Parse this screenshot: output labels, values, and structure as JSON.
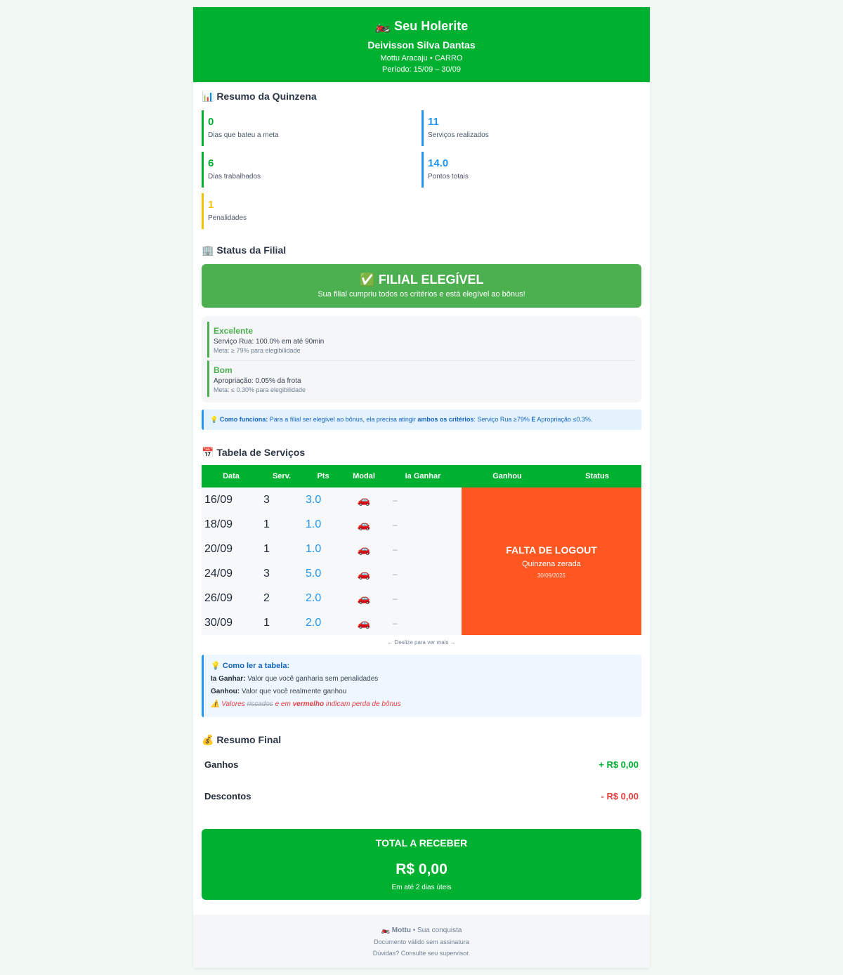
{
  "header": {
    "title": "🏍️ Seu Holerite",
    "name": "Deivisson Silva Dantas",
    "branch": "Mottu Aracaju • CARRO",
    "period": "Período: 15/09 – 30/09"
  },
  "summary": {
    "title": "📊 Resumo da Quinzena",
    "stats": [
      {
        "value": "0",
        "label": "Dias que bateu a meta"
      },
      {
        "value": "11",
        "label": "Serviços realizados"
      },
      {
        "value": "6",
        "label": "Dias trabalhados"
      },
      {
        "value": "14.0",
        "label": "Pontos totais"
      },
      {
        "value": "1",
        "label": "Penalidades"
      }
    ]
  },
  "filial": {
    "title": "🏢 Status da Filial",
    "status": "✅ FILIAL ELEGÍVEL",
    "status_sub": "Sua filial cumpriu todos os critérios e está elegível ao bônus!",
    "criteria": [
      {
        "level": "Excelente",
        "desc": "Serviço Rua: 100.0% em até 90min",
        "meta": "Meta: ≥ 79% para elegibilidade"
      },
      {
        "level": "Bom",
        "desc": "Apropriação: 0.05% da frota",
        "meta": "Meta: ≤ 0.30% para elegibilidade"
      }
    ],
    "info": {
      "icon": "💡",
      "label": "Como funciona:",
      "t1": " Para a filial ser elegível ao bônus, ela precisa atingir ",
      "bold": "ambos os critérios",
      "t2": ": Serviço Rua ≥79% ",
      "and": "E",
      "t3": " Apropriação ≤0.3%."
    }
  },
  "table": {
    "title": "📅 Tabela de Serviços",
    "headers": [
      "Data",
      "Serv.",
      "Pts",
      "Modal",
      "Ia Ganhar",
      "Ganhou",
      "Status"
    ],
    "rows": [
      {
        "date": "16/09",
        "serv": "3",
        "pts": "3.0",
        "modal": "🚗",
        "ia": "–"
      },
      {
        "date": "18/09",
        "serv": "1",
        "pts": "1.0",
        "modal": "🚗",
        "ia": "–"
      },
      {
        "date": "20/09",
        "serv": "1",
        "pts": "1.0",
        "modal": "🚗",
        "ia": "–"
      },
      {
        "date": "24/09",
        "serv": "3",
        "pts": "5.0",
        "modal": "🚗",
        "ia": "–"
      },
      {
        "date": "26/09",
        "serv": "2",
        "pts": "2.0",
        "modal": "🚗",
        "ia": "–"
      },
      {
        "date": "30/09",
        "serv": "1",
        "pts": "2.0",
        "modal": "🚗",
        "ia": "–"
      }
    ],
    "status_title": "FALTA DE LOGOUT",
    "status_sub": "Quinzena zerada",
    "status_date": "30/09/2025",
    "scroll_hint": "← Deslize para ver mais →"
  },
  "howto": {
    "title": "💡 Como ler a tabela:",
    "l1_label": "Ia Ganhar:",
    "l1_text": " Valor que você ganharia sem penalidades",
    "l2_label": "Ganhou:",
    "l2_text": " Valor que você realmente ganhou",
    "warn_icon": "⚠️",
    "warn_t1": " Valores ",
    "warn_strike": "riscados",
    "warn_t2": " e em ",
    "warn_bold": "vermelho",
    "warn_t3": " indicam perda de bônus"
  },
  "final": {
    "title": "💰 Resumo Final",
    "earnings_label": "Ganhos",
    "earnings_value": "+ R$ 0,00",
    "discounts_label": "Descontos",
    "discounts_value": "- R$ 0,00",
    "total_label": "TOTAL A RECEBER",
    "total_value": "R$ 0,00",
    "total_note": "Em até 2 dias úteis"
  },
  "footer": {
    "brand": "🏍️ Mottu",
    "tagline": " • Sua conquista",
    "line2": "Documento válido sem assinatura",
    "line3": "Dúvidas? Consulte seu supervisor."
  },
  "colors": {
    "brand_green": "#00b031",
    "eligible_green": "#4caf50",
    "info_blue": "#2196f3",
    "penalty_yellow": "#f6c000",
    "alert_orange": "#ff5722",
    "negative_red": "#e53e3e"
  }
}
